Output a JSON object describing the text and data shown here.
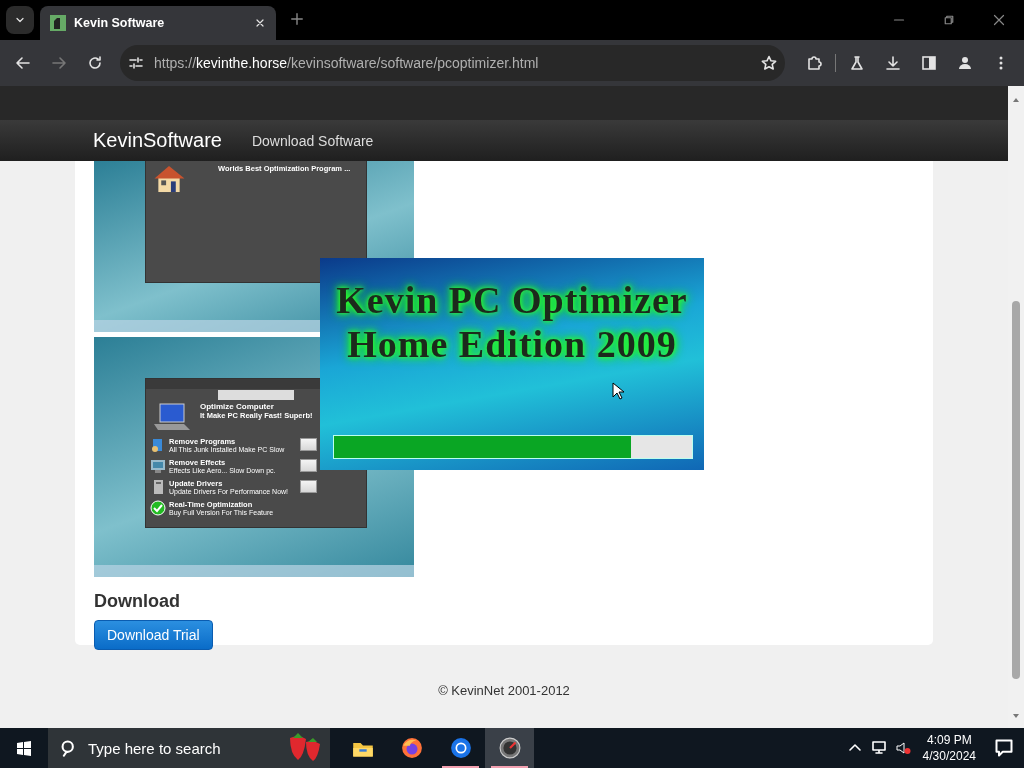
{
  "browser": {
    "tab": {
      "title": "Kevin Software",
      "selected": true
    },
    "url": {
      "scheme": "https://",
      "host": "kevinthe.horse",
      "path": "/kevinsoftware/software/pcoptimizer.html"
    }
  },
  "navbar": {
    "brand": "KevinSoftware",
    "links": [
      "Download Software"
    ]
  },
  "screenshots": [
    {
      "kind": "welcome",
      "subtitle": "Worlds Best Optimization Program ..."
    },
    {
      "kind": "optimize",
      "heading": "Optimize Computer",
      "subheading": "It Make PC Really Fast! Superb!",
      "rows": [
        {
          "kind": "programs",
          "title": "Remove Programs",
          "desc": "All This Junk Installed Make PC Slow"
        },
        {
          "kind": "effects",
          "title": "Remove Effects",
          "desc": "Effects Like Aero... Slow Down pc."
        },
        {
          "kind": "drivers",
          "title": "Update Drivers",
          "desc": "Update Drivers For Performance Now!"
        },
        {
          "kind": "realtime",
          "title": "Real-Time Optimization",
          "desc": "Buy Full Version For This Feature"
        }
      ]
    }
  ],
  "splash": {
    "lines": [
      "Kevin PC Optimizer",
      "Home Edition 2009"
    ],
    "level": 0.83
  },
  "download": {
    "heading": "Download",
    "button": "Download Trial"
  },
  "footer": "© KevinNet 2001-2012",
  "taskbar": {
    "search_placeholder": "Type here to search",
    "apps": [
      {
        "kind": "folder",
        "running": false,
        "selected": false
      },
      {
        "kind": "firefox",
        "running": false,
        "selected": false
      },
      {
        "kind": "chrome",
        "running": true,
        "selected": false
      },
      {
        "kind": "gauge",
        "running": true,
        "selected": true
      }
    ],
    "time": "4:09 PM",
    "date": "4/30/2024"
  }
}
